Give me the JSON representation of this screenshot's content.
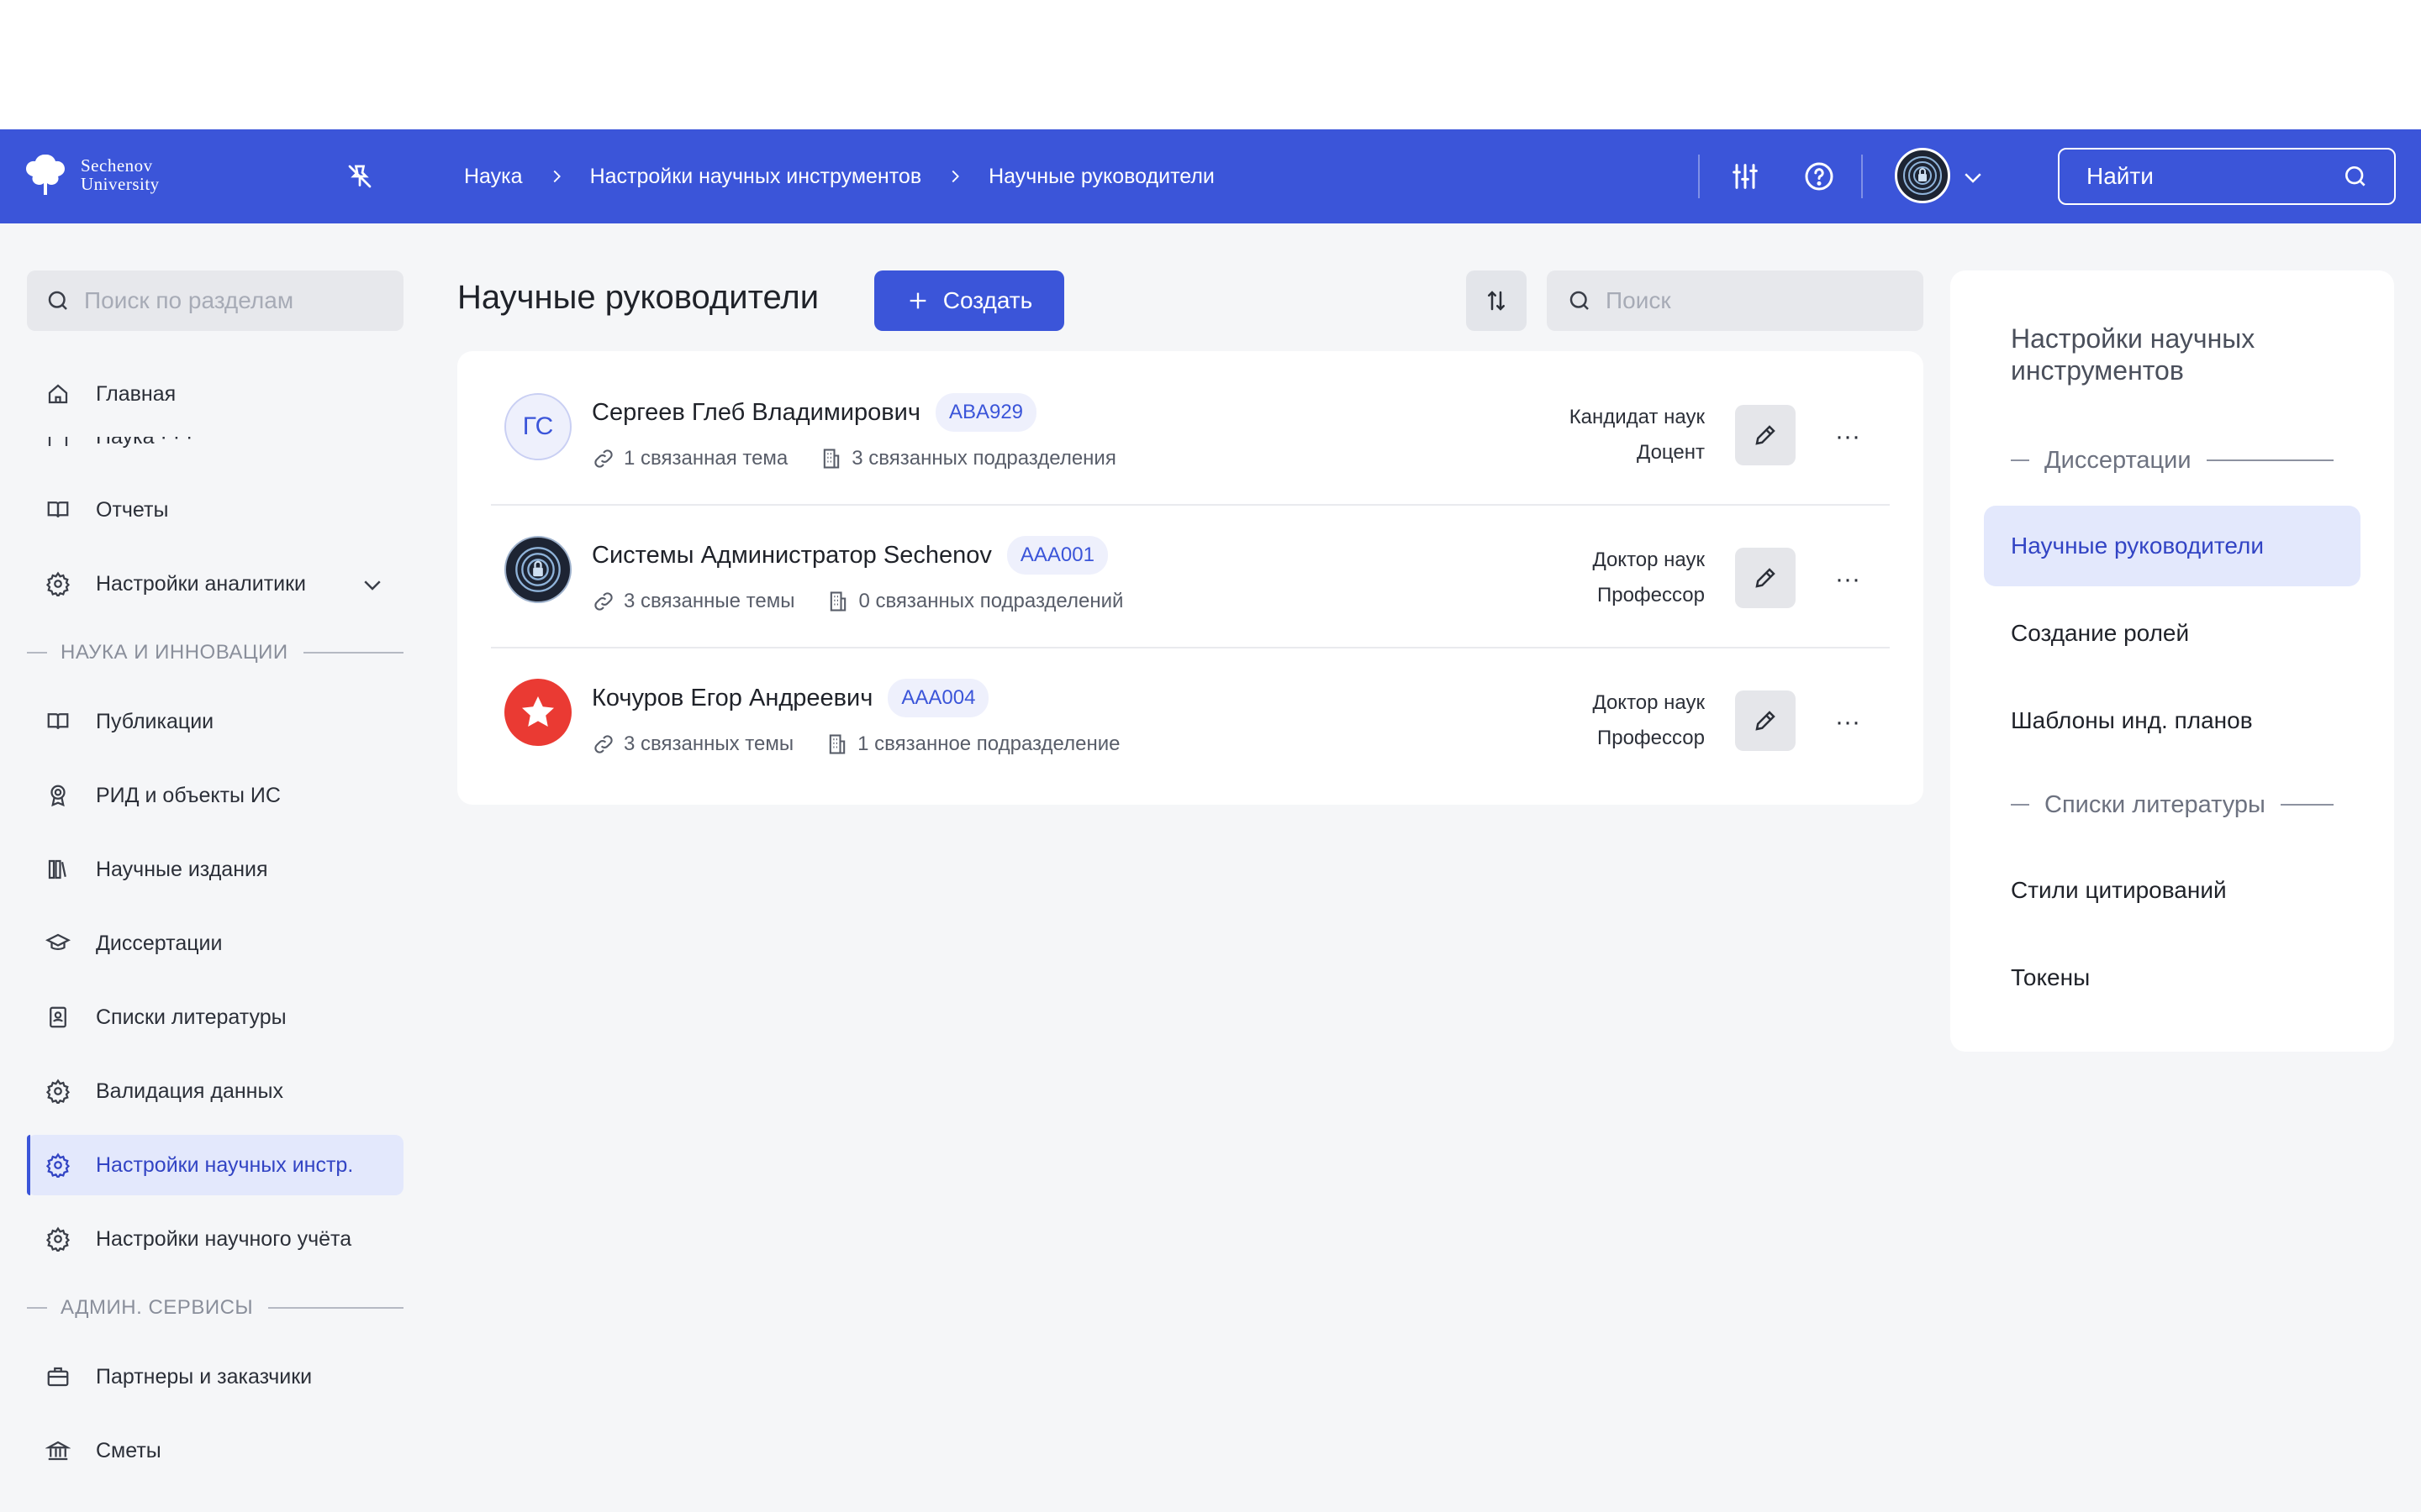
{
  "header": {
    "logo_line1": "Sechenov",
    "logo_line2": "University",
    "breadcrumbs": [
      "Наука",
      "Настройки научных инструментов",
      "Научные руководители"
    ],
    "search_placeholder": "Найти"
  },
  "sidebar": {
    "search_placeholder": "Поиск по разделам",
    "items": [
      {
        "label": "Главная",
        "icon": "home-icon"
      },
      {
        "label": "Отчеты",
        "icon": "book-icon"
      },
      {
        "label": "Настройки аналитики",
        "icon": "gear-icon"
      }
    ],
    "section1": "НАУКА И ИННОВАЦИИ",
    "science_items": [
      {
        "label": "Публикации",
        "icon": "book-icon"
      },
      {
        "label": "РИД и объекты ИС",
        "icon": "award-icon"
      },
      {
        "label": "Научные издания",
        "icon": "library-icon"
      },
      {
        "label": "Диссертации",
        "icon": "graduation-cap-icon"
      },
      {
        "label": "Списки литературы",
        "icon": "contact-book-icon"
      },
      {
        "label": "Валидация данных",
        "icon": "gear-icon"
      },
      {
        "label": "Настройки научных инстр.",
        "icon": "gear-icon"
      },
      {
        "label": "Настройки научного учёта",
        "icon": "gear-icon"
      }
    ],
    "section2": "АДМИН. СЕРВИСЫ",
    "admin_items": [
      {
        "label": "Партнеры и заказчики",
        "icon": "briefcase-icon"
      },
      {
        "label": "Сметы",
        "icon": "bank-icon"
      }
    ]
  },
  "main": {
    "title": "Научные руководители",
    "create_label": "Создать",
    "search_placeholder": "Поиск",
    "rows": [
      {
        "initials": "ГС",
        "name": "Сергеев Глеб Владимирович",
        "code": "ABA929",
        "topics": "1 связанная тема",
        "units": "3 связанных подразделения",
        "degree": "Кандидат наук",
        "title": "Доцент"
      },
      {
        "initials": "",
        "name": "Системы Администратор Sechenov",
        "code": "AAA001",
        "topics": "3 связанные темы",
        "units": "0 связанных подразделений",
        "degree": "Доктор наук",
        "title": "Профессор"
      },
      {
        "initials": "",
        "name": "Кочуров Егор Андреевич",
        "code": "AAA004",
        "topics": "3 связанных темы",
        "units": "1 связанное подразделение",
        "degree": "Доктор наук",
        "title": "Профессор"
      }
    ],
    "more_glyph": "···"
  },
  "right_panel": {
    "title": "Настройки научных инструментов",
    "section1": "Диссертации",
    "items1": [
      "Научные руководители",
      "Создание ролей",
      "Шаблоны инд. планов"
    ],
    "section2": "Списки литературы",
    "items2": [
      "Стили цитирований",
      "Токены"
    ]
  },
  "colors": {
    "accent": "#3b55d9",
    "active_bg": "#e3e8fc",
    "avatar_red": "#ea3a33"
  }
}
